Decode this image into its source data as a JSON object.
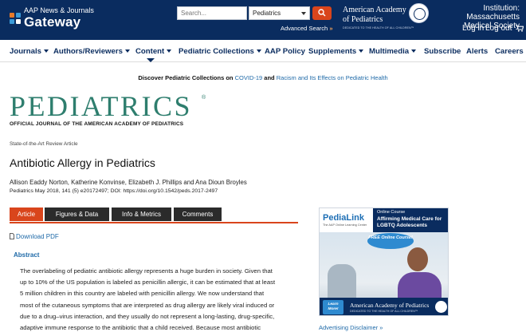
{
  "header": {
    "brand_small": "AAP News & Journals",
    "brand_big": "Gateway",
    "search": {
      "placeholder": "Search...",
      "scope": "Pediatrics",
      "advanced_label": "Advanced Search",
      "advanced_arrow": "»"
    },
    "aap": {
      "line1": "American Academy",
      "line2": "of Pediatrics",
      "tagline": "DEDICATED TO THE HEALTH OF ALL CHILDREN™"
    },
    "institution": "Institution: Massachusetts Medical Society",
    "login": "Log in",
    "logout": "Log out",
    "colors": {
      "navy": "#0a2c5f",
      "accent": "#d9451c",
      "journal": "#2e7e6e",
      "link": "#1f6aa8"
    }
  },
  "nav": {
    "items": [
      {
        "label": "Journals",
        "dropdown": true
      },
      {
        "label": "Authors/Reviewers",
        "dropdown": true
      },
      {
        "label": "Content",
        "dropdown": true
      },
      {
        "label": "Pediatric Collections",
        "dropdown": true
      },
      {
        "label": "AAP Policy",
        "dropdown": false
      },
      {
        "label": "Supplements",
        "dropdown": true
      },
      {
        "label": "Multimedia",
        "dropdown": true
      },
      {
        "label": "Subscribe",
        "dropdown": false
      },
      {
        "label": "Alerts",
        "dropdown": false
      },
      {
        "label": "Careers",
        "dropdown": false
      }
    ],
    "active": "Content"
  },
  "announcement": {
    "lead": "Discover Pediatric Collections on",
    "link1": "COVID-19",
    "joiner": "and",
    "link2": "Racism and Its Effects on Pediatric Health"
  },
  "journal": {
    "name": "PEDIATRICS",
    "reg": "®",
    "subtitle": "OFFICIAL JOURNAL OF THE AMERICAN ACADEMY OF PEDIATRICS"
  },
  "article": {
    "type": "State-of-the-Art Review Article",
    "title": "Antibiotic Allergy in Pediatrics",
    "authors": "Allison Eaddy Norton, Katherine Konvinse, Elizabeth J. Phillips and Ana Dioun Broyles",
    "citation": "Pediatrics May 2018, 141 (5) e20172497; DOI: https://doi.org/10.1542/peds.2017-2497",
    "tabs": [
      {
        "label": "Article",
        "active": true
      },
      {
        "label": "Figures & Data",
        "active": false
      },
      {
        "label": "Info & Metrics",
        "active": false
      },
      {
        "label": "Comments",
        "active": false
      }
    ],
    "download_label": "Download PDF",
    "abstract_heading": "Abstract",
    "abstract_lines": [
      "The overlabeling of pediatric antibiotic allergy represents a huge burden in society. Given that",
      "up to 10% of the US population is labeled as penicillin allergic, it can be estimated that at least",
      "5 million children in this country are labeled with penicillin allergy. We now understand that",
      "most of the cutaneous symptoms that are interpreted as drug allergy are likely viral induced or",
      "due to a drug–virus interaction, and they usually do not represent a long-lasting, drug-specific,",
      "adaptive immune response to the antibiotic that a child received. Because most antibiotic"
    ]
  },
  "ad": {
    "logo": "PediaLink",
    "logo_sub": "The AAP Online Learning Center",
    "online_course": "Online Course",
    "headline": "Affirming Medical Care for LGBTQ Adolescents",
    "free": "FREE Online Course!",
    "learn": "Learn More!",
    "aap": "American Academy of Pediatrics",
    "aap_tag": "DEDICATED TO THE HEALTH OF ALL CHILDREN™",
    "disclaimer": "Advertising Disclaimer »"
  }
}
